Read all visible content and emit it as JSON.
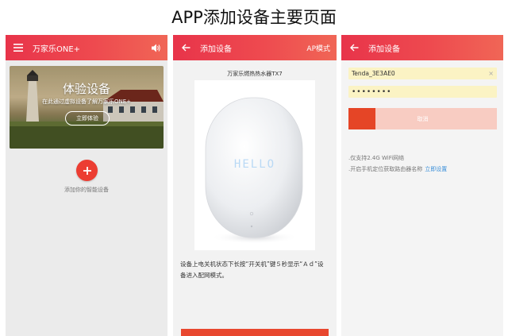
{
  "page_title": "APP添加设备主要页面",
  "screen1": {
    "app_title": "万家乐ONE+",
    "menu_icon": "hamburger-menu-icon",
    "sound_icon": "speaker-icon",
    "banner": {
      "title": "体验设备",
      "subtitle": "在此通过虚拟设备了解万家乐ONE+",
      "button_label": "立即体验"
    },
    "add_button_icon": "plus-icon",
    "add_label": "添加你的智能设备"
  },
  "screen2": {
    "app_title": "添加设备",
    "back_icon": "back-arrow-icon",
    "mode_label": "AP模式",
    "device_name": "万家乐燃热热水器TX7",
    "display_text": "HELLO",
    "instruction_1": "设备上电关机状态下长按“开关机”键５秒显示“Ａｄ”设",
    "instruction_2": "备进入配网模式。"
  },
  "screen3": {
    "app_title": "添加设备",
    "back_icon": "back-arrow-icon",
    "ssid_value": "Tenda_3E3AE0",
    "clear_icon": "clear-x-icon",
    "password_value": "••••••••",
    "cancel_label": "取消",
    "note1": ".仅支持2.4G WiFi网络",
    "note2": ".开启手机定位获取路由器名称",
    "note2_link": "立即设置"
  },
  "colors": {
    "appbar_start": "#e8344a",
    "appbar_end": "#f06656",
    "accent_red": "#ec3d32",
    "link_blue": "#3b8fd9"
  }
}
